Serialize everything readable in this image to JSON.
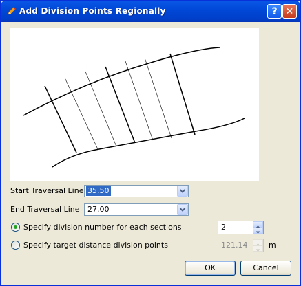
{
  "window": {
    "title": "Add Division Points Regionally",
    "help_label": "?",
    "close_label": "✕"
  },
  "form": {
    "start_label": "Start Traversal Line",
    "start_value": "35.50",
    "end_label": "End Traversal Line",
    "end_value": "27.00",
    "option_number_label": "Specify division number for each sections",
    "option_number_value": "2",
    "option_number_selected": true,
    "option_distance_label": "Specify target distance division points",
    "option_distance_value": "121.14",
    "option_distance_unit": "m"
  },
  "buttons": {
    "ok_label": "OK",
    "cancel_label": "Cancel"
  },
  "colors": {
    "titlebar": "#0149d8",
    "selection": "#316ac5",
    "radio_dot": "#21a121"
  }
}
